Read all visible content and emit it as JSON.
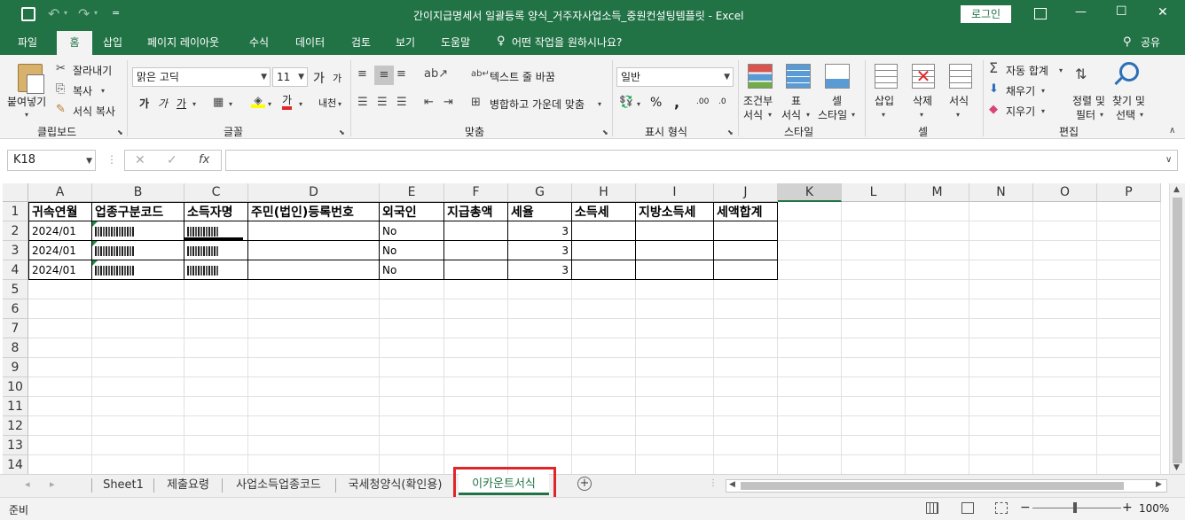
{
  "window": {
    "title": "간이지급명세서 일괄등록 양식_거주자사업소득_중원컨설팅템플릿  -  Excel",
    "login": "로그인",
    "qat_more": "=",
    "restore_icon": "ribbon-display-icon",
    "min": "—",
    "max": "☐",
    "close": "✕"
  },
  "ribbon_tabs": [
    {
      "label": "파일"
    },
    {
      "label": "홈"
    },
    {
      "label": "삽입"
    },
    {
      "label": "페이지 레이아웃"
    },
    {
      "label": "수식"
    },
    {
      "label": "데이터"
    },
    {
      "label": "검토"
    },
    {
      "label": "보기"
    },
    {
      "label": "도움말"
    }
  ],
  "tell_me": "어떤 작업을 원하시나요?",
  "share": "공유",
  "clipboard": {
    "paste": "붙여넣기",
    "cut": "잘라내기",
    "copy": "복사",
    "format_painter": "서식 복사",
    "group": "클립보드"
  },
  "font": {
    "name": "맑은 고딕",
    "size": "11",
    "grow": "가",
    "shrink": "가",
    "bold": "가",
    "italic": "가",
    "underline": "가",
    "font_color": "가",
    "phonetic": "내천",
    "group": "글꼴"
  },
  "alignment": {
    "wrap": "텍스트 줄 바꿈",
    "merge": "병합하고 가운데 맞춤",
    "group": "맞춤"
  },
  "number": {
    "format": "일반",
    "percent": "%",
    "comma": ",",
    "inc": ".00",
    "dec": ".0",
    "group": "표시 형식"
  },
  "styles": {
    "cond": "조건부",
    "cond2": "서식",
    "table": "표",
    "table2": "서식",
    "cell": "셀",
    "cell2": "스타일",
    "group": "스타일"
  },
  "cells": {
    "insert": "삽입",
    "delete": "삭제",
    "format": "서식",
    "group": "셀"
  },
  "editing": {
    "autosum": "자동 합계",
    "fill": "채우기",
    "clear": "지우기",
    "sort": "정렬 및",
    "sort2": "필터",
    "find": "찾기 및",
    "find2": "선택",
    "group": "편집"
  },
  "formula_bar": {
    "name_box": "K18",
    "cancel": "✕",
    "enter": "✓",
    "fx": "fx",
    "value": ""
  },
  "columns": [
    "A",
    "B",
    "C",
    "D",
    "E",
    "F",
    "G",
    "H",
    "I",
    "J",
    "K",
    "L",
    "M",
    "N",
    "O",
    "P"
  ],
  "rows": [
    "1",
    "2",
    "3",
    "4",
    "5",
    "6",
    "7",
    "8",
    "9",
    "10",
    "11",
    "12",
    "13",
    "14"
  ],
  "headers": [
    "귀속연월",
    "업종구분코드",
    "소득자명",
    "주민(법인)등록번호",
    "외국인",
    "지급총액",
    "세율",
    "소득세",
    "지방소득세",
    "세액합계"
  ],
  "data_rows": [
    {
      "a": "2024/01",
      "e": "No",
      "g": "3"
    },
    {
      "a": "2024/01",
      "e": "No",
      "g": "3"
    },
    {
      "a": "2024/01",
      "e": "No",
      "g": "3"
    }
  ],
  "sheets": [
    {
      "label": "Sheet1"
    },
    {
      "label": "제출요령"
    },
    {
      "label": "사업소득업종코드"
    },
    {
      "label": "국세청양식(확인용)"
    },
    {
      "label": "이카운트서식"
    }
  ],
  "add_sheet": "+",
  "status": {
    "ready": "준비",
    "zoom": "100%",
    "minus": "−",
    "plus": "+"
  },
  "colors": {
    "excel_green": "#217346",
    "highlight_red": "#e0262b"
  }
}
